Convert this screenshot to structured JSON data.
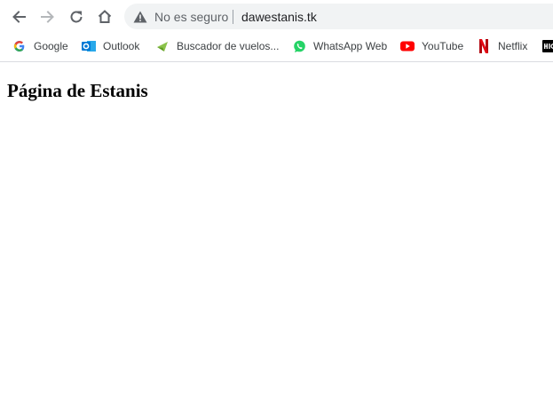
{
  "browser": {
    "security_label": "No es seguro",
    "url": "dawestanis.tk",
    "icons": {
      "back": "back-arrow-icon",
      "forward": "forward-arrow-icon",
      "reload": "reload-icon",
      "home": "home-icon",
      "security": "warning-triangle-icon"
    }
  },
  "bookmarks": [
    {
      "label": "Google",
      "icon": "google-icon"
    },
    {
      "label": "Outlook",
      "icon": "outlook-icon"
    },
    {
      "label": "Buscador de vuelos...",
      "icon": "flight-search-icon"
    },
    {
      "label": "WhatsApp Web",
      "icon": "whatsapp-icon"
    },
    {
      "label": "YouTube",
      "icon": "youtube-icon"
    },
    {
      "label": "Netflix",
      "icon": "netflix-icon"
    },
    {
      "label": "",
      "icon": "hbo-icon"
    }
  ],
  "page": {
    "heading": "Página de Estanis"
  },
  "colors": {
    "youtube": "#ff0000",
    "netflix": "#e50914",
    "whatsapp": "#25d366",
    "outlook": "#0078d4",
    "flight": "#8bc34a"
  }
}
